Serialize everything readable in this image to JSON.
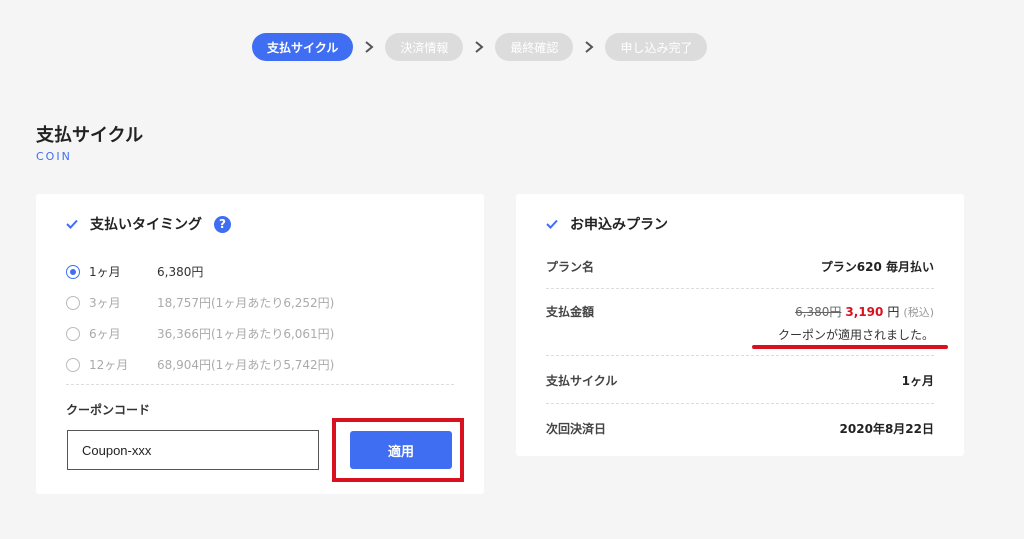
{
  "stepper": {
    "steps": [
      {
        "label": "支払サイクル",
        "active": true
      },
      {
        "label": "決済情報",
        "active": false
      },
      {
        "label": "最終確認",
        "active": false
      },
      {
        "label": "申し込み完了",
        "active": false
      }
    ]
  },
  "section": {
    "title": "支払サイクル",
    "subtitle": "COIN"
  },
  "timing_card": {
    "title": "支払いタイミング",
    "help_glyph": "?",
    "options": [
      {
        "period": "1ヶ月",
        "price": "6,380円",
        "detail": "",
        "checked": true
      },
      {
        "period": "3ヶ月",
        "price": "18,757円",
        "detail": "(1ヶ月あたり6,252円)",
        "checked": false
      },
      {
        "period": "6ヶ月",
        "price": "36,366円",
        "detail": "(1ヶ月あたり6,061円)",
        "checked": false
      },
      {
        "period": "12ヶ月",
        "price": "68,904円",
        "detail": "(1ヶ月あたり5,742円)",
        "checked": false
      }
    ],
    "coupon_label": "クーポンコード",
    "coupon_value": "Coupon-xxx",
    "apply_label": "適用"
  },
  "plan_card": {
    "title": "お申込みプラン",
    "rows": {
      "plan_name": {
        "label": "プラン名",
        "value": "プラン620 毎月払い"
      },
      "amount": {
        "label": "支払金額",
        "old_price": "6,380円",
        "new_price": "3,190",
        "yen": "円",
        "tax": "(税込)",
        "coupon_message": "クーポンが適用されました。"
      },
      "cycle": {
        "label": "支払サイクル",
        "value": "1ヶ月"
      },
      "next_date": {
        "label": "次回決済日",
        "value": "2020年8月22日"
      }
    }
  },
  "colors": {
    "accent": "#3f6ef3",
    "highlight": "#d9111e",
    "inactive_step": "#dcdcdc"
  }
}
